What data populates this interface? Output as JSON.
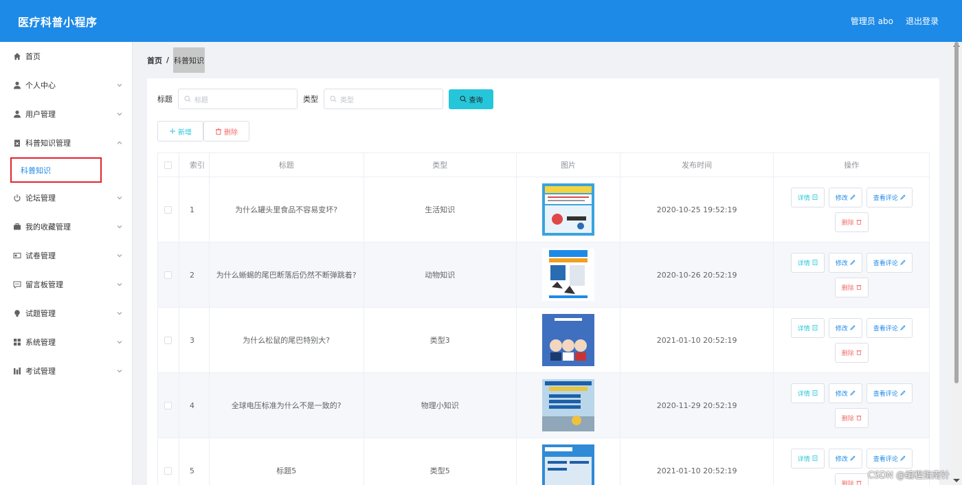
{
  "header": {
    "app_title": "医疗科普小程序",
    "admin_label": "管理员 abo",
    "logout_label": "退出登录"
  },
  "sidebar": {
    "items": [
      {
        "label": "首页",
        "icon": "home-icon",
        "has_arrow": false
      },
      {
        "label": "个人中心",
        "icon": "user-icon",
        "has_arrow": true
      },
      {
        "label": "用户管理",
        "icon": "user-icon",
        "has_arrow": true
      },
      {
        "label": "科普知识管理",
        "icon": "clipboard-icon",
        "has_arrow": true,
        "expanded": true
      },
      {
        "label": "论坛管理",
        "icon": "power-icon",
        "has_arrow": true
      },
      {
        "label": "我的收藏管理",
        "icon": "briefcase-icon",
        "has_arrow": true
      },
      {
        "label": "试卷管理",
        "icon": "card-icon",
        "has_arrow": true
      },
      {
        "label": "留言板管理",
        "icon": "chat-icon",
        "has_arrow": true
      },
      {
        "label": "试题管理",
        "icon": "bulb-icon",
        "has_arrow": true
      },
      {
        "label": "系统管理",
        "icon": "grid-icon",
        "has_arrow": true
      },
      {
        "label": "考试管理",
        "icon": "chart-icon",
        "has_arrow": true
      }
    ],
    "sub_item": "科普知识",
    "highlight_color": "#e0242c"
  },
  "breadcrumb": {
    "home": "首页",
    "separator": "/",
    "current": "科普知识"
  },
  "search": {
    "title_label": "标题",
    "title_placeholder": "标题",
    "type_label": "类型",
    "type_placeholder": "类型",
    "query_label": "查询"
  },
  "actions": {
    "add_label": "新增",
    "delete_label": "删除"
  },
  "table": {
    "headers": [
      "索引",
      "标题",
      "类型",
      "图片",
      "发布时间",
      "操作"
    ],
    "rows": [
      {
        "index": "1",
        "title": "为什么罐头里食品不容易变坏?",
        "type": "生活知识",
        "time": "2020-10-25 19:52:19"
      },
      {
        "index": "2",
        "title": "为什么蜥蜴的尾巴断落后仍然不断弹跳着?",
        "type": "动物知识",
        "time": "2020-10-26 20:52:19"
      },
      {
        "index": "3",
        "title": "为什么松鼠的尾巴特别大?",
        "type": "类型3",
        "time": "2021-01-10 20:52:19"
      },
      {
        "index": "4",
        "title": "全球电压标准为什么不是一致的?",
        "type": "物理小知识",
        "time": "2020-11-29 20:52:19"
      },
      {
        "index": "5",
        "title": "标题5",
        "type": "类型5",
        "time": "2021-01-10 20:52:19"
      }
    ],
    "op_labels": {
      "detail": "详情",
      "edit": "修改",
      "comment": "查看评论",
      "remove": "删除"
    }
  },
  "watermark": "CSDN @编程指南针",
  "colors": {
    "header_bg": "#1d8ae7",
    "accent_cyan": "#26c6da",
    "danger": "#f56c6c"
  }
}
